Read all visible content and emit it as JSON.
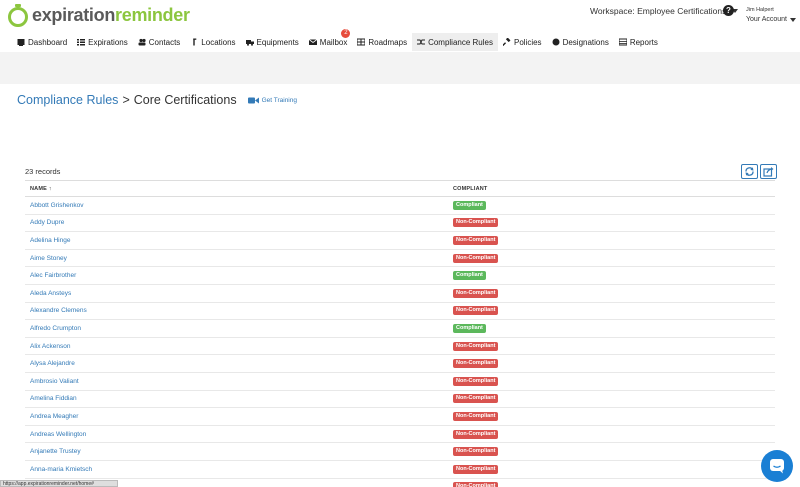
{
  "brand": {
    "logo_part1": "expiration",
    "logo_part2": "reminder"
  },
  "header": {
    "workspace_label": "Workspace: Employee Certifications",
    "help_glyph": "?",
    "user_name": "Jim Halpert",
    "account_label": "Your Account"
  },
  "nav": [
    {
      "label": "Dashboard",
      "icon": "dashboard-icon"
    },
    {
      "label": "Expirations",
      "icon": "list-icon"
    },
    {
      "label": "Contacts",
      "icon": "users-icon"
    },
    {
      "label": "Locations",
      "icon": "location-icon"
    },
    {
      "label": "Equipments",
      "icon": "truck-icon"
    },
    {
      "label": "Mailbox",
      "icon": "envelope-icon",
      "badge": "2"
    },
    {
      "label": "Roadmaps",
      "icon": "roadmap-icon"
    },
    {
      "label": "Compliance Rules",
      "icon": "shuffle-icon",
      "active": true
    },
    {
      "label": "Policies",
      "icon": "gavel-icon"
    },
    {
      "label": "Designations",
      "icon": "certificate-icon"
    },
    {
      "label": "Reports",
      "icon": "table-icon"
    }
  ],
  "page": {
    "breadcrumb_parent": "Compliance Rules",
    "breadcrumb_sep": ">",
    "title": "Core Certifications",
    "training_label": "Get Training",
    "records_count": "23 records"
  },
  "table": {
    "headers": {
      "name": "NAME",
      "sort_glyph": "↑",
      "compliant": "COMPLIANT"
    },
    "rows": [
      {
        "name": "Abbott Grishenkov",
        "status": "Compliant"
      },
      {
        "name": "Addy Dupre",
        "status": "Non-Compliant"
      },
      {
        "name": "Adelina Hinge",
        "status": "Non-Compliant"
      },
      {
        "name": "Aime Stoney",
        "status": "Non-Compliant"
      },
      {
        "name": "Alec Fairbrother",
        "status": "Compliant"
      },
      {
        "name": "Aleda Ansteys",
        "status": "Non-Compliant"
      },
      {
        "name": "Alexandre Clemens",
        "status": "Non-Compliant"
      },
      {
        "name": "Alfredo Crumpton",
        "status": "Compliant"
      },
      {
        "name": "Alix Ackenson",
        "status": "Non-Compliant"
      },
      {
        "name": "Alysa Alejandre",
        "status": "Non-Compliant"
      },
      {
        "name": "Ambrosio Valiant",
        "status": "Non-Compliant"
      },
      {
        "name": "Amelina Fiddian",
        "status": "Non-Compliant"
      },
      {
        "name": "Andrea Meagher",
        "status": "Non-Compliant"
      },
      {
        "name": "Andreas Wellington",
        "status": "Non-Compliant"
      },
      {
        "name": "Anjanette Trustey",
        "status": "Non-Compliant"
      },
      {
        "name": "Anna-maria Kmietsch",
        "status": "Non-Compliant"
      },
      {
        "name": "",
        "status": "Non-Compliant"
      }
    ]
  },
  "statusbar": {
    "url": "https://app.expirationreminder.net/home#"
  },
  "colors": {
    "link": "#337ab7",
    "compliant": "#5cb85c",
    "noncompliant": "#d9534f",
    "brand_green": "#8cc63f",
    "chat": "#1a7fd4"
  }
}
